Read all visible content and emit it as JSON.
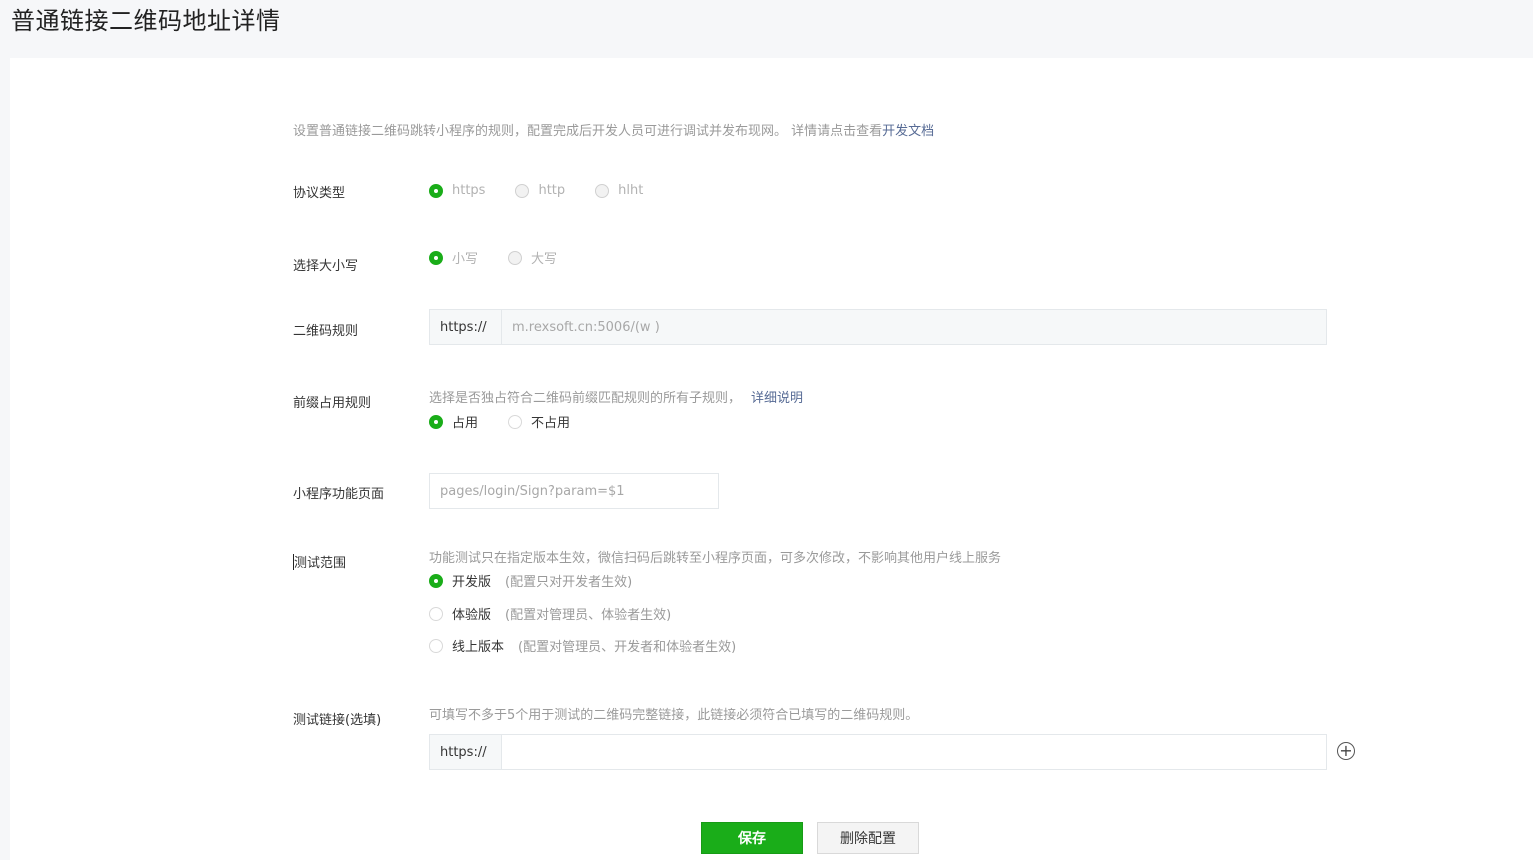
{
  "page": {
    "title": "普通链接二维码地址详情"
  },
  "intro": {
    "text": "设置普通链接二维码跳转小程序的规则，配置完成后开发人员可进行调试并发布现网。 详情请点击查看",
    "link": "开发文档"
  },
  "protocol": {
    "label": "协议类型",
    "options": [
      "https",
      "http",
      "hlht"
    ],
    "selected": "https"
  },
  "case": {
    "label": "选择大小写",
    "options": [
      "小写",
      "大写"
    ],
    "selected": "小写"
  },
  "qr_rule": {
    "label": "二维码规则",
    "prefix": "https://",
    "value": "m.rexsoft.cn:5006/(w )"
  },
  "prefix_rule": {
    "label": "前缀占用规则",
    "desc": "选择是否独占符合二维码前缀匹配规则的所有子规则，",
    "link": "详细说明",
    "options": [
      "占用",
      "不占用"
    ],
    "selected": "占用"
  },
  "mini_page": {
    "label": "小程序功能页面",
    "placeholder": "pages/login/Sign?param=$1"
  },
  "test_scope": {
    "label": "测试范围",
    "desc": "功能测试只在指定版本生效，微信扫码后跳转至小程序页面，可多次修改，不影响其他用户线上服务",
    "options": [
      {
        "name": "开发版",
        "note": "(配置只对开发者生效)"
      },
      {
        "name": "体验版",
        "note": "(配置对管理员、体验者生效)"
      },
      {
        "name": "线上版本",
        "note": "(配置对管理员、开发者和体验者生效)"
      }
    ],
    "selected": "开发版"
  },
  "test_link": {
    "label": "测试链接(选填)",
    "desc": "可填写不多于5个用于测试的二维码完整链接，此链接必须符合已填写的二维码规则。",
    "prefix": "https://",
    "value": ""
  },
  "actions": {
    "save": "保存",
    "delete": "删除配置"
  },
  "colors": {
    "primary": "#1aad19",
    "link": "#576b95",
    "muted": "#9a9a9a"
  }
}
